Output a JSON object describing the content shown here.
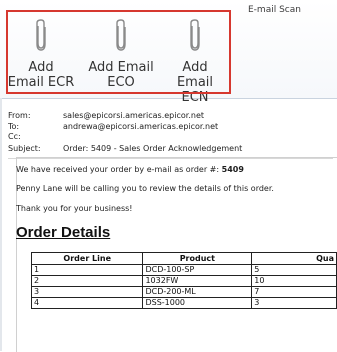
{
  "ribbon": {
    "group_label": "E-mail Scan",
    "buttons": [
      {
        "line1": "Add",
        "line2": "Email ECR",
        "icon": "paperclip-icon"
      },
      {
        "line1": "Add Email",
        "line2": "ECO",
        "icon": "paperclip-icon"
      },
      {
        "line1": "Add",
        "line2": "Email ECN",
        "icon": "paperclip-icon"
      }
    ],
    "highlight_color": "#d6382f"
  },
  "headers": {
    "from_label": "From:",
    "from_value": "sales@epicorsi.americas.epicor.net",
    "to_label": "To:",
    "to_value": "andrewa@epicorsi.americas.epicor.net",
    "cc_label": "Cc:",
    "cc_value": "",
    "subject_label": "Subject:",
    "subject_value": "Order: 5409  - Sales Order Acknowledgement"
  },
  "body": {
    "line1_prefix": "We have received your order by e-mail as order #: ",
    "order_number": "5409",
    "line2": "Penny Lane will be calling you to review the details of this order.",
    "line3": "Thank you for your business!",
    "heading": "Order Details"
  },
  "table": {
    "columns": [
      "Order Line",
      "Product",
      "Qua"
    ],
    "rows": [
      [
        "1",
        "DCD-100-SP",
        "5"
      ],
      [
        "2",
        "1032FW",
        "10"
      ],
      [
        "3",
        "DCD-200-ML",
        "7"
      ],
      [
        "4",
        "DSS-1000",
        "3"
      ]
    ]
  }
}
